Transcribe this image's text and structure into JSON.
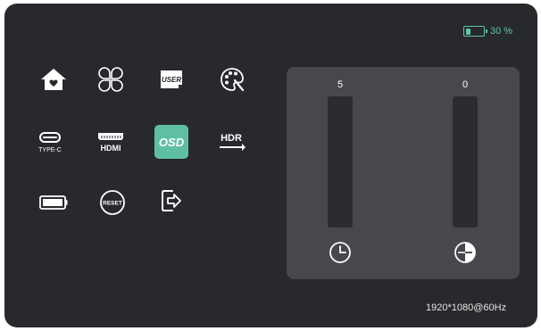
{
  "battery": {
    "percent_label": "30 %",
    "level": 0.3,
    "color": "#5fc5ac"
  },
  "menu": {
    "icons": [
      {
        "name": "home-icon",
        "active": false
      },
      {
        "name": "quad-view-icon",
        "active": false
      },
      {
        "name": "user-mode-icon",
        "label": "USER",
        "active": false
      },
      {
        "name": "color-palette-icon",
        "active": false
      },
      {
        "name": "type-c-input-icon",
        "label": "TYPE-C",
        "active": false
      },
      {
        "name": "hdmi-input-icon",
        "label": "HDMI",
        "active": false
      },
      {
        "name": "osd-settings-icon",
        "label": "OSD",
        "active": true
      },
      {
        "name": "hdr-icon",
        "label": "HDR",
        "active": false
      },
      {
        "name": "battery-settings-icon",
        "active": false
      },
      {
        "name": "reset-icon",
        "label": "RESET",
        "active": false
      },
      {
        "name": "exit-icon",
        "active": false
      }
    ]
  },
  "osd_panel": {
    "timeout": {
      "value": "5",
      "icon": "clock-icon",
      "level": 0.0
    },
    "transparency": {
      "value": "0",
      "icon": "transparency-icon",
      "level": 0.0
    }
  },
  "status": {
    "resolution": "1920*1080@60Hz"
  },
  "colors": {
    "accent": "#5fbfa5",
    "background": "#28292c",
    "panel": "#46484c"
  }
}
